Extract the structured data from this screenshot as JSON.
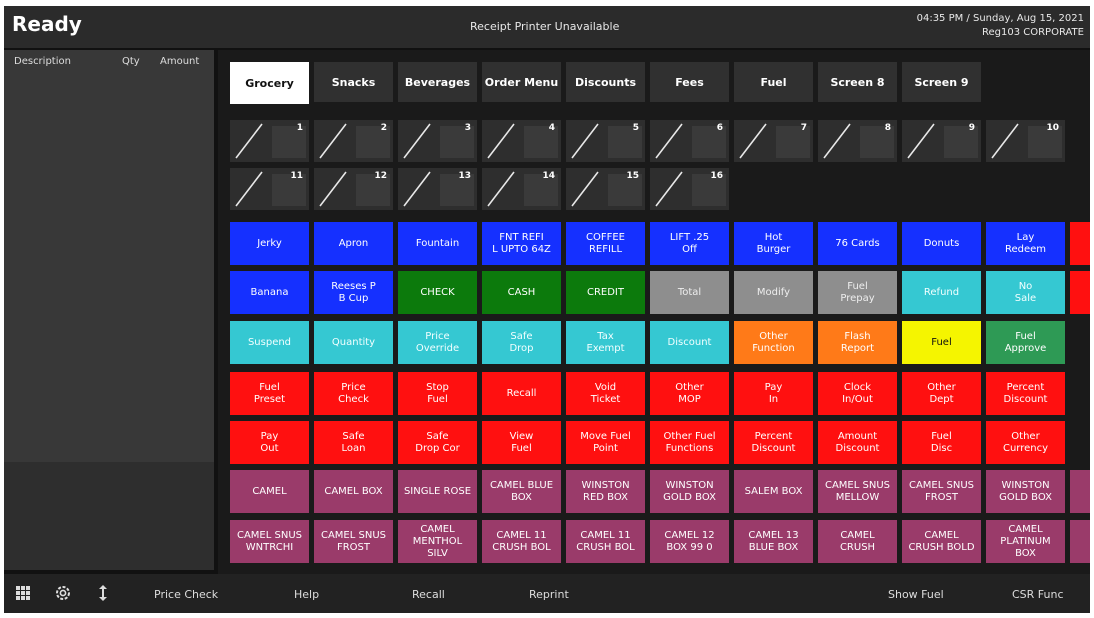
{
  "header": {
    "status": "Ready",
    "printer_status": "Receipt Printer Unavailable",
    "datetime": "04:35 PM / Sunday, Aug 15, 2021",
    "register": "Reg103  CORPORATE"
  },
  "receipt": {
    "col_description": "Description",
    "col_qty": "Qty",
    "col_amount": "Amount"
  },
  "tabs": [
    "Grocery",
    "Snacks",
    "Beverages",
    "Order Menu",
    "Discounts",
    "Fees",
    "Fuel",
    "Screen 8",
    "Screen 9"
  ],
  "active_tab": "Grocery",
  "pump_slots": [
    "1",
    "2",
    "3",
    "4",
    "5",
    "6",
    "7",
    "8",
    "9",
    "10",
    "11",
    "12",
    "13",
    "14",
    "15",
    "16"
  ],
  "key_rows": [
    [
      {
        "label": "Jerky",
        "color": "blue"
      },
      {
        "label": "Apron",
        "color": "blue"
      },
      {
        "label": "Fountain",
        "color": "blue"
      },
      {
        "label": "FNT REFI\nL UPTO 64Z",
        "color": "blue"
      },
      {
        "label": "COFFEE\nREFILL",
        "color": "blue"
      },
      {
        "label": "LIFT .25\nOff",
        "color": "blue"
      },
      {
        "label": "Hot\nBurger",
        "color": "blue"
      },
      {
        "label": "76 Cards",
        "color": "blue"
      },
      {
        "label": "Donuts",
        "color": "blue"
      },
      {
        "label": "Lay\nRedeem",
        "color": "blue"
      },
      {
        "label": "",
        "color": "red"
      }
    ],
    [
      {
        "label": "Banana",
        "color": "blue"
      },
      {
        "label": "Reeses P\nB Cup",
        "color": "blue"
      },
      {
        "label": "CHECK",
        "color": "green"
      },
      {
        "label": "CASH",
        "color": "green"
      },
      {
        "label": "CREDIT",
        "color": "green"
      },
      {
        "label": "Total",
        "color": "gray"
      },
      {
        "label": "Modify",
        "color": "gray"
      },
      {
        "label": "Fuel\nPrepay",
        "color": "gray"
      },
      {
        "label": "Refund",
        "color": "cyan"
      },
      {
        "label": "No\nSale",
        "color": "cyan"
      },
      {
        "label": "",
        "color": "red"
      }
    ],
    [
      {
        "label": "Suspend",
        "color": "cyan"
      },
      {
        "label": "Quantity",
        "color": "cyan"
      },
      {
        "label": "Price\nOverride",
        "color": "cyan"
      },
      {
        "label": "Safe\nDrop",
        "color": "cyan"
      },
      {
        "label": "Tax\nExempt",
        "color": "cyan"
      },
      {
        "label": "Discount",
        "color": "cyan"
      },
      {
        "label": "Other\nFunction",
        "color": "orange"
      },
      {
        "label": "Flash\nReport",
        "color": "orange"
      },
      {
        "label": "Fuel",
        "color": "yellow"
      },
      {
        "label": "Fuel\nApprove",
        "color": "fgreen"
      }
    ],
    [
      {
        "label": "Fuel\nPreset",
        "color": "red"
      },
      {
        "label": "Price\nCheck",
        "color": "red"
      },
      {
        "label": "Stop\nFuel",
        "color": "red"
      },
      {
        "label": "Recall",
        "color": "red"
      },
      {
        "label": "Void\nTicket",
        "color": "red"
      },
      {
        "label": "Other\nMOP",
        "color": "red"
      },
      {
        "label": "Pay\nIn",
        "color": "red"
      },
      {
        "label": "Clock\nIn/Out",
        "color": "red"
      },
      {
        "label": "Other\nDept",
        "color": "red"
      },
      {
        "label": "Percent\nDiscount",
        "color": "red"
      }
    ],
    [
      {
        "label": "Pay\nOut",
        "color": "red"
      },
      {
        "label": "Safe\nLoan",
        "color": "red"
      },
      {
        "label": "Safe\nDrop Cor",
        "color": "red"
      },
      {
        "label": "View\nFuel",
        "color": "red"
      },
      {
        "label": "Move Fuel\nPoint",
        "color": "red"
      },
      {
        "label": "Other Fuel\nFunctions",
        "color": "red"
      },
      {
        "label": "Percent\nDiscount",
        "color": "red"
      },
      {
        "label": "Amount\nDiscount",
        "color": "red"
      },
      {
        "label": "Fuel\nDisc",
        "color": "red"
      },
      {
        "label": "Other\nCurrency",
        "color": "red"
      }
    ],
    [
      {
        "label": "CAMEL",
        "color": "maroon"
      },
      {
        "label": "CAMEL BOX",
        "color": "maroon"
      },
      {
        "label": "SINGLE ROSE",
        "color": "maroon"
      },
      {
        "label": "CAMEL BLUE\nBOX",
        "color": "maroon"
      },
      {
        "label": "WINSTON\nRED BOX",
        "color": "maroon"
      },
      {
        "label": "WINSTON\nGOLD BOX",
        "color": "maroon"
      },
      {
        "label": "SALEM BOX",
        "color": "maroon"
      },
      {
        "label": "CAMEL SNUS\nMELLOW",
        "color": "maroon"
      },
      {
        "label": "CAMEL SNUS\nFROST",
        "color": "maroon"
      },
      {
        "label": "WINSTON\nGOLD BOX",
        "color": "maroon"
      },
      {
        "label": "CA",
        "color": "maroon"
      }
    ],
    [
      {
        "label": "CAMEL SNUS\nWNTRCHI",
        "color": "maroon"
      },
      {
        "label": "CAMEL SNUS\nFROST",
        "color": "maroon"
      },
      {
        "label": "CAMEL\nMENTHOL\nSILV",
        "color": "maroon"
      },
      {
        "label": "CAMEL 11\nCRUSH BOL",
        "color": "maroon"
      },
      {
        "label": "CAMEL 11\nCRUSH BOL",
        "color": "maroon"
      },
      {
        "label": "CAMEL 12\nBOX 99 0",
        "color": "maroon"
      },
      {
        "label": "CAMEL 13\nBLUE BOX",
        "color": "maroon"
      },
      {
        "label": "CAMEL\nCRUSH",
        "color": "maroon"
      },
      {
        "label": "CAMEL\nCRUSH BOLD",
        "color": "maroon"
      },
      {
        "label": "CAMEL\nPLATINUM\nBOX",
        "color": "maroon"
      },
      {
        "label": "C\nBL",
        "color": "maroon"
      }
    ]
  ],
  "footer": {
    "icons": [
      "grid-icon",
      "gear-icon",
      "updown-arrow-icon"
    ],
    "price_check": "Price Check",
    "help": "Help",
    "recall": "Recall",
    "reprint": "Reprint",
    "show_fuel": "Show Fuel",
    "csr_func": "CSR Func"
  },
  "colors": {
    "blue": "#1530ff",
    "green": "#0c7a0c",
    "gray": "#8e8e8e",
    "cyan": "#35c8d2",
    "orange": "#ff7a18",
    "yellow": "#f5f500",
    "fgreen": "#2e9a55",
    "red": "#ff1010",
    "maroon": "#9a3b6a"
  }
}
